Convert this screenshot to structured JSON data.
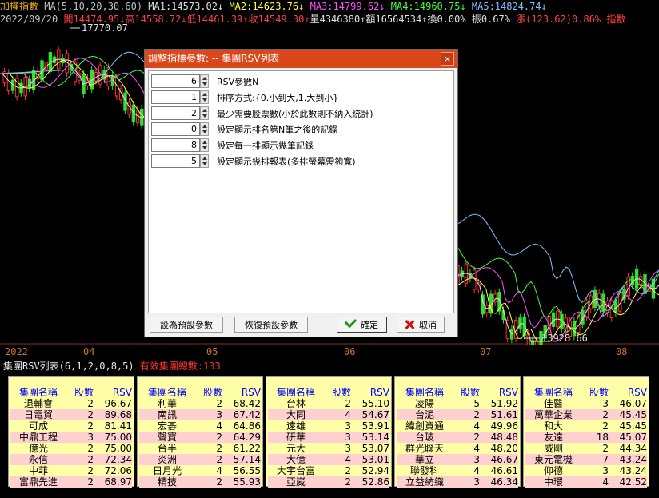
{
  "header": {
    "line1": [
      {
        "text": "加權指數 ",
        "color": "#e8b020"
      },
      {
        "text": "MA(5,10,20,30,60) ",
        "color": "#c0c0c0"
      },
      {
        "text": "MA1:14573.02↓ ",
        "color": "#e0e0e0"
      },
      {
        "text": "MA2:14623.76↓ ",
        "color": "#ffff40"
      },
      {
        "text": "MA3:14799.62↓ ",
        "color": "#ff50ff"
      },
      {
        "text": "MA4:14960.75↓ ",
        "color": "#40ff40"
      },
      {
        "text": "MA5:14824.74↓",
        "color": "#80c0ff"
      }
    ],
    "line2": [
      {
        "text": "2022/09/20 ",
        "color": "#c0c0c0"
      },
      {
        "text": "開14474.95↓",
        "color": "#ff4040"
      },
      {
        "text": "高14558.72↓",
        "color": "#ff4040"
      },
      {
        "text": "低14461.39↑",
        "color": "#ff4040"
      },
      {
        "text": "收14549.30↑",
        "color": "#ff4040"
      },
      {
        "text": "量4346380↑",
        "color": "#e0e0e0"
      },
      {
        "text": "額16564534↑",
        "color": "#e0e0e0"
      },
      {
        "text": "換0.00% ",
        "color": "#e0e0e0"
      },
      {
        "text": "振0.67% ",
        "color": "#e0e0e0"
      },
      {
        "text": "漲(123.62)0.86% ",
        "color": "#ff4040"
      },
      {
        "text": "指數",
        "color": "#ff4040"
      }
    ]
  },
  "chart": {
    "high_label": "17770.07",
    "low_label": "13928.66",
    "x_ticks": [
      "2022",
      "04",
      "05",
      "06",
      "07",
      "08"
    ],
    "ma_colors": {
      "ma1": "#e0e0e0",
      "ma2": "#ffff40",
      "ma3": "#ff50ff",
      "ma4": "#40ff40",
      "ma5": "#80c0ff"
    },
    "up_color": "#ff3030",
    "down_color": "#30e030"
  },
  "rsv_list": {
    "title": "集團RSV列表(6,1,2,0,8,5)",
    "count_label": "有效集團總數:133",
    "headers": [
      "集團名稱",
      "股數",
      "RSV"
    ],
    "panels": [
      [
        [
          "退輔會",
          "2",
          "96.67"
        ],
        [
          "日電貿",
          "2",
          "89.68"
        ],
        [
          "可成",
          "2",
          "81.41"
        ],
        [
          "中鼎工程",
          "3",
          "75.00"
        ],
        [
          "億光",
          "2",
          "75.00"
        ],
        [
          "永信",
          "2",
          "72.34"
        ],
        [
          "中菲",
          "2",
          "72.06"
        ],
        [
          "富鼎先進",
          "2",
          "68.97"
        ]
      ],
      [
        [
          "利華",
          "2",
          "68.42"
        ],
        [
          "南訊",
          "3",
          "67.42"
        ],
        [
          "宏碁",
          "4",
          "64.86"
        ],
        [
          "聲寶",
          "2",
          "64.29"
        ],
        [
          "台半",
          "2",
          "61.22"
        ],
        [
          "炎洲",
          "2",
          "57.14"
        ],
        [
          "日月光",
          "4",
          "56.55"
        ],
        [
          "精技",
          "2",
          "55.93"
        ]
      ],
      [
        [
          "台林",
          "2",
          "55.10"
        ],
        [
          "大同",
          "4",
          "54.67"
        ],
        [
          "遠雄",
          "3",
          "53.91"
        ],
        [
          "研華",
          "3",
          "53.14"
        ],
        [
          "元大",
          "3",
          "53.07"
        ],
        [
          "大億",
          "4",
          "53.01"
        ],
        [
          "大宇台富",
          "2",
          "52.94"
        ],
        [
          "亞崴",
          "2",
          "52.86"
        ]
      ],
      [
        [
          "凌陽",
          "5",
          "51.92"
        ],
        [
          "台泥",
          "2",
          "51.61"
        ],
        [
          "緯創資通",
          "4",
          "49.96"
        ],
        [
          "台玻",
          "2",
          "48.48"
        ],
        [
          "群光聯天",
          "4",
          "48.20"
        ],
        [
          "華立",
          "3",
          "46.67"
        ],
        [
          "聯發科",
          "4",
          "46.61"
        ],
        [
          "立益紡織",
          "3",
          "46.34"
        ]
      ],
      [
        [
          "佳醫",
          "3",
          "46.07"
        ],
        [
          "萬華企業",
          "2",
          "45.45"
        ],
        [
          "和大",
          "2",
          "45.45"
        ],
        [
          "友達",
          "18",
          "45.07"
        ],
        [
          "威剛",
          "2",
          "44.34"
        ],
        [
          "東元電機",
          "7",
          "43.24"
        ],
        [
          "仰德",
          "3",
          "43.24"
        ],
        [
          "中環",
          "4",
          "42.52"
        ]
      ]
    ]
  },
  "dialog": {
    "title": "調整指標參數: -- 集團RSV列表",
    "close_label": "×",
    "params": [
      {
        "value": "6",
        "label": "RSV參數N"
      },
      {
        "value": "1",
        "label": "排序方式:{0.小到大,1.大到小}"
      },
      {
        "value": "2",
        "label": "最少需要股票數(小於此數則不納入統計)"
      },
      {
        "value": "0",
        "label": "設定顯示排名第N筆之後的記錄"
      },
      {
        "value": "8",
        "label": "設定每一排顯示幾筆記錄"
      },
      {
        "value": "5",
        "label": "設定顯示幾排報表(多排螢幕需夠寬)"
      }
    ],
    "buttons": {
      "set_default": "設為預設參數",
      "restore_default": "恢復預設參數",
      "ok": "確定",
      "cancel": "取消"
    }
  }
}
